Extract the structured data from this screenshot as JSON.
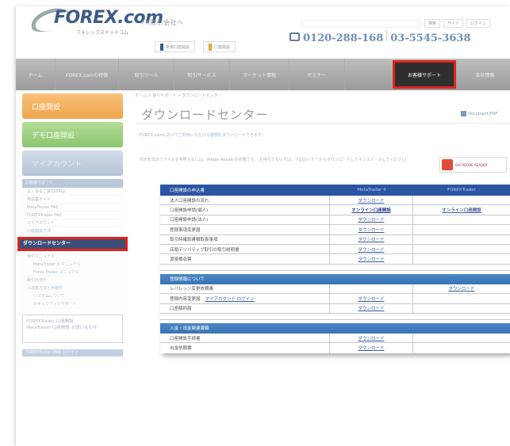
{
  "header": {
    "brand": "FOREX.com",
    "brand_sub": "フォレックスドットコム",
    "tagline": "FX取引会社へ",
    "buttons": [
      "新規口座開設",
      "口座開設"
    ],
    "phone1": "0120-288-168",
    "phone2": "03-5545-3638",
    "utility": [
      "検索",
      "サイト",
      "ログイン"
    ]
  },
  "nav": {
    "items": [
      "ホーム",
      "FOREX.comの特徴",
      "取引ツール",
      "取引サービス",
      "マーケット情報",
      "セミナー"
    ],
    "active_item": "お客様サポート",
    "last_item": "会社情報"
  },
  "sidebar": {
    "big": [
      "口座開設",
      "デモ口座開設",
      "マイアカウント"
    ],
    "heading": "お客様サポート",
    "links": [
      "よくあるご質問(FAQ)",
      "用語集ガイド",
      "MetaTrader FAQ",
      "FOREXTrader FAQ",
      "マイアカウント",
      "口座開設方法"
    ],
    "active_link": "ダウンロードセンター",
    "sub_heading": "取引マニュアル",
    "sub_links": [
      "MetaTrader 4 マニュアル",
      "Forex Trader マニュアル"
    ],
    "links2": [
      "取引の流れ",
      "入出金方法と手数料",
      "システムについて",
      "セキュリティとサポート"
    ],
    "box_text": "FOREXTrader 口座開設\nMetaTrader 口座開設 お問い合わせ",
    "bottom_bar": "FOREXTrader Web ログイン"
  },
  "main": {
    "breadcrumb": "ホーム > 取引サポート > ダウンロードセンター",
    "title": "ダウンロードセンター",
    "pdf_link": "Document PDF",
    "description": "FOREX.comにおいてご利用いただける書類をダウンロードできます。",
    "note": "PDF形式のファイルを参照するには、Adobe Readerが必要です。 お持ちでない方は、下記のバナーからダウンロードしてインストールしてください。",
    "adobe": "Get ADOBE READER"
  },
  "table": {
    "header": {
      "c1": "口座開設の申込書",
      "c2": "MetaTrader 4",
      "c3": "FOREXTrader"
    },
    "sec1_rows": [
      {
        "c1": "法人口座開設の流れ",
        "c2": "ダウンロード",
        "c3": ""
      },
      {
        "c1": "口座開設申請(個人)",
        "c2": "オンライン口座開設",
        "c3": "オンライン口座開設"
      },
      {
        "c1": "口座開設申請(法人)",
        "c2": "ダウンロード",
        "c3": ""
      },
      {
        "c1": "登録事項変更届",
        "c2": "ダウンロード",
        "c3": ""
      },
      {
        "c1": "取引時確認書類取扱事項",
        "c2": "ダウンロード",
        "c3": ""
      },
      {
        "c1": "店頭デリバティブ取引の取引説明書",
        "c2": "ダウンロード",
        "c3": ""
      },
      {
        "c1": "源泉徴収票",
        "c2": "ダウンロード",
        "c3": ""
      }
    ],
    "sec2_title": "登録情報について",
    "sec2_rows": [
      {
        "c1": "レバレッジ変更依頼書",
        "c2": "",
        "c3": "ダウンロード"
      },
      {
        "c1": "登録内容変更届",
        "c1_link": "マイアカウント ログイン",
        "c2": "ダウンロード",
        "c3": ""
      },
      {
        "c1": "口座解約届",
        "c2": "ダウンロード",
        "c3": ""
      }
    ],
    "sec3_title": "入金・出金関連書類",
    "sec3_rows": [
      {
        "c1": "口座開設手続書",
        "c2": "ダウンロード",
        "c3": ""
      },
      {
        "c1": "出金依頼書",
        "c2": "ダウンロード",
        "c3": ""
      }
    ]
  },
  "colors": {
    "nav_active": "#2e2e2e",
    "highlight": "#e2231a",
    "table_header": "#2a55a2",
    "sidebar_active": "#3d4f79"
  }
}
